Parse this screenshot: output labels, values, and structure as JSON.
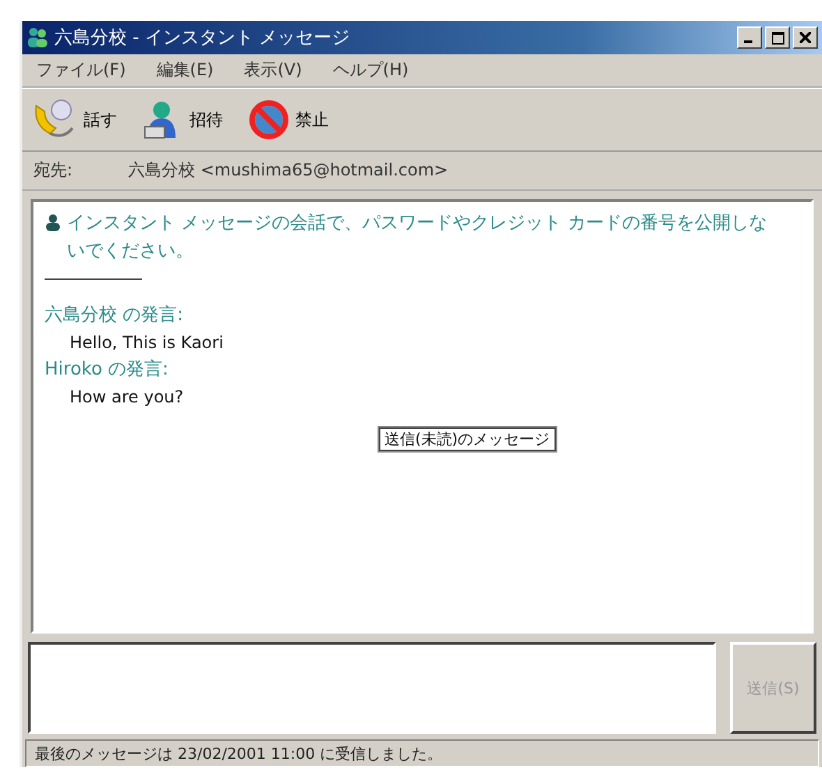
{
  "window": {
    "title": "六島分校 - インスタント メッセージ"
  },
  "menu": [
    "ファイル(F)",
    "編集(E)",
    "表示(V)",
    "ヘルプ(H)"
  ],
  "toolbar": [
    {
      "kind": "talk",
      "label": "話す"
    },
    {
      "kind": "invite",
      "label": "招待"
    },
    {
      "kind": "block",
      "label": "禁止"
    }
  ],
  "recipient": {
    "label": "宛先:",
    "value": "六島分校 <mushima65@hotmail.com>"
  },
  "warning": "インスタント メッセージの会話で、パスワードやクレジット カードの番号を公開しないでください。",
  "messages": [
    {
      "sender": "六島分校 の発言:",
      "text": "Hello, This is Kaori"
    },
    {
      "sender": "Hiroko の発言:",
      "text": "How are you?"
    }
  ],
  "tooltip": "送信(未読)のメッセージ",
  "send_button": {
    "label": "送信(S)",
    "disabled": true
  },
  "status_bar": "最後のメッセージは 23/02/2001 11:00 に受信しました。"
}
